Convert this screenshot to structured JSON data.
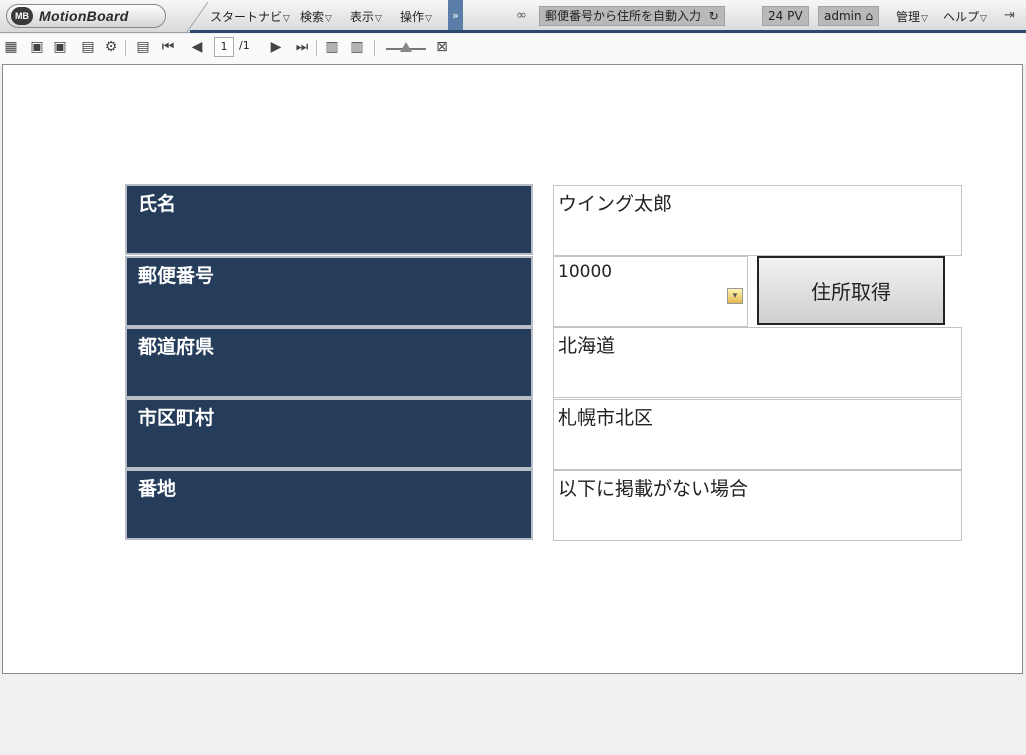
{
  "app": {
    "logo_badge": "MB",
    "logo_text": "MotionBoard"
  },
  "topbar": {
    "menus": [
      {
        "label": "スタートナビ"
      },
      {
        "label": "検索"
      },
      {
        "label": "表示"
      },
      {
        "label": "操作"
      }
    ],
    "board_title": "郵便番号から住所を自動入力",
    "pv": "24 PV",
    "user": "admin",
    "admin_menu": "管理",
    "help_menu": "ヘルプ"
  },
  "toolbar": {
    "page_current": "1",
    "page_total": "/1"
  },
  "form": {
    "rows": [
      {
        "label": "氏名",
        "value": "ウイング太郎"
      },
      {
        "label": "郵便番号",
        "value": "10000"
      },
      {
        "label": "都道府県",
        "value": "北海道"
      },
      {
        "label": "市区町村",
        "value": "札幌市北区"
      },
      {
        "label": "番地",
        "value": "以下に掲載がない場合"
      }
    ],
    "fetch_button": "住所取得"
  }
}
